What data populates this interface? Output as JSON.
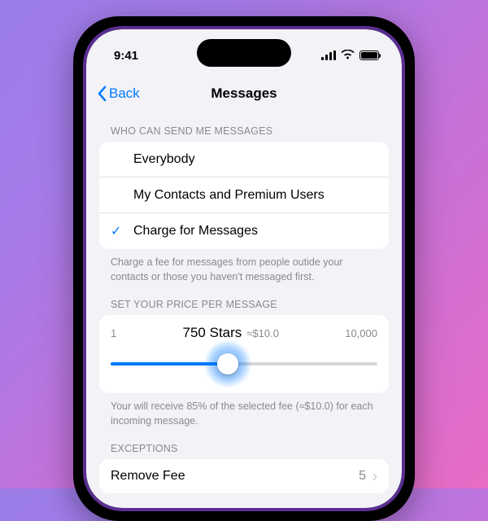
{
  "status": {
    "time": "9:41"
  },
  "nav": {
    "back": "Back",
    "title": "Messages"
  },
  "sections": {
    "who_header": "WHO CAN SEND ME MESSAGES",
    "options": [
      {
        "label": "Everybody",
        "selected": false
      },
      {
        "label": "My Contacts and Premium Users",
        "selected": false
      },
      {
        "label": "Charge for Messages",
        "selected": true
      }
    ],
    "who_footer": "Charge a fee for messages from people outide your contacts or those you haven't messaged first.",
    "price_header": "SET YOUR PRICE PER MESSAGE",
    "price": {
      "min": "1",
      "max": "10,000",
      "value_label": "750 Stars",
      "approx": "≈$10.0",
      "percent": 44
    },
    "price_footer": "Your will receive 85% of the selected fee (≈$10.0) for each incoming message.",
    "exceptions_header": "EXCEPTIONS",
    "remove_fee": {
      "label": "Remove Fee",
      "count": "5"
    }
  }
}
